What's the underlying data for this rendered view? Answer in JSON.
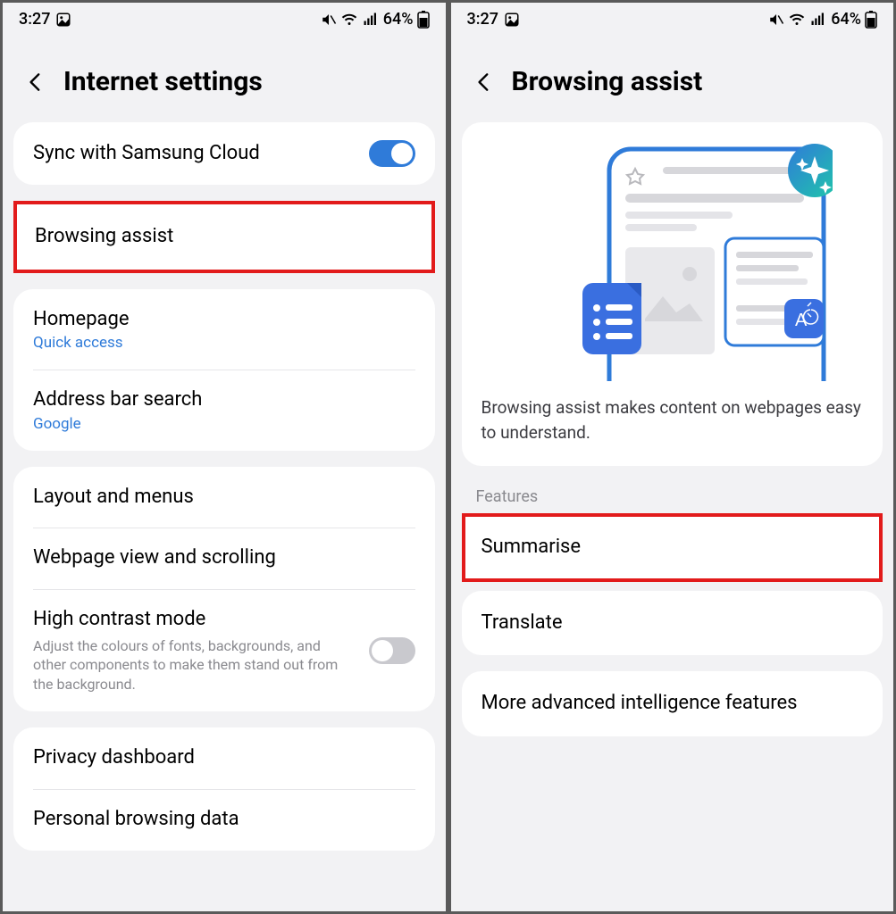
{
  "statusbar": {
    "time": "3:27",
    "battery_text": "64%"
  },
  "left": {
    "header_title": "Internet settings",
    "sync_row": {
      "title": "Sync with Samsung Cloud"
    },
    "browsing_assist": {
      "title": "Browsing assist"
    },
    "homepage": {
      "title": "Homepage",
      "sub": "Quick access"
    },
    "address_bar": {
      "title": "Address bar search",
      "sub": "Google"
    },
    "layout_menus": {
      "title": "Layout and menus"
    },
    "webpage_view": {
      "title": "Webpage view and scrolling"
    },
    "high_contrast": {
      "title": "High contrast mode",
      "desc": "Adjust the colours of fonts, backgrounds, and other components to make them stand out from the background."
    },
    "privacy_dashboard": {
      "title": "Privacy dashboard"
    },
    "personal_browsing": {
      "title": "Personal browsing data"
    }
  },
  "right": {
    "header_title": "Browsing assist",
    "desc": "Browsing assist makes content on webpages easy to understand.",
    "section_label": "Features",
    "summarise": {
      "title": "Summarise"
    },
    "translate": {
      "title": "Translate"
    },
    "more_ai": {
      "title": "More advanced intelligence features"
    }
  }
}
